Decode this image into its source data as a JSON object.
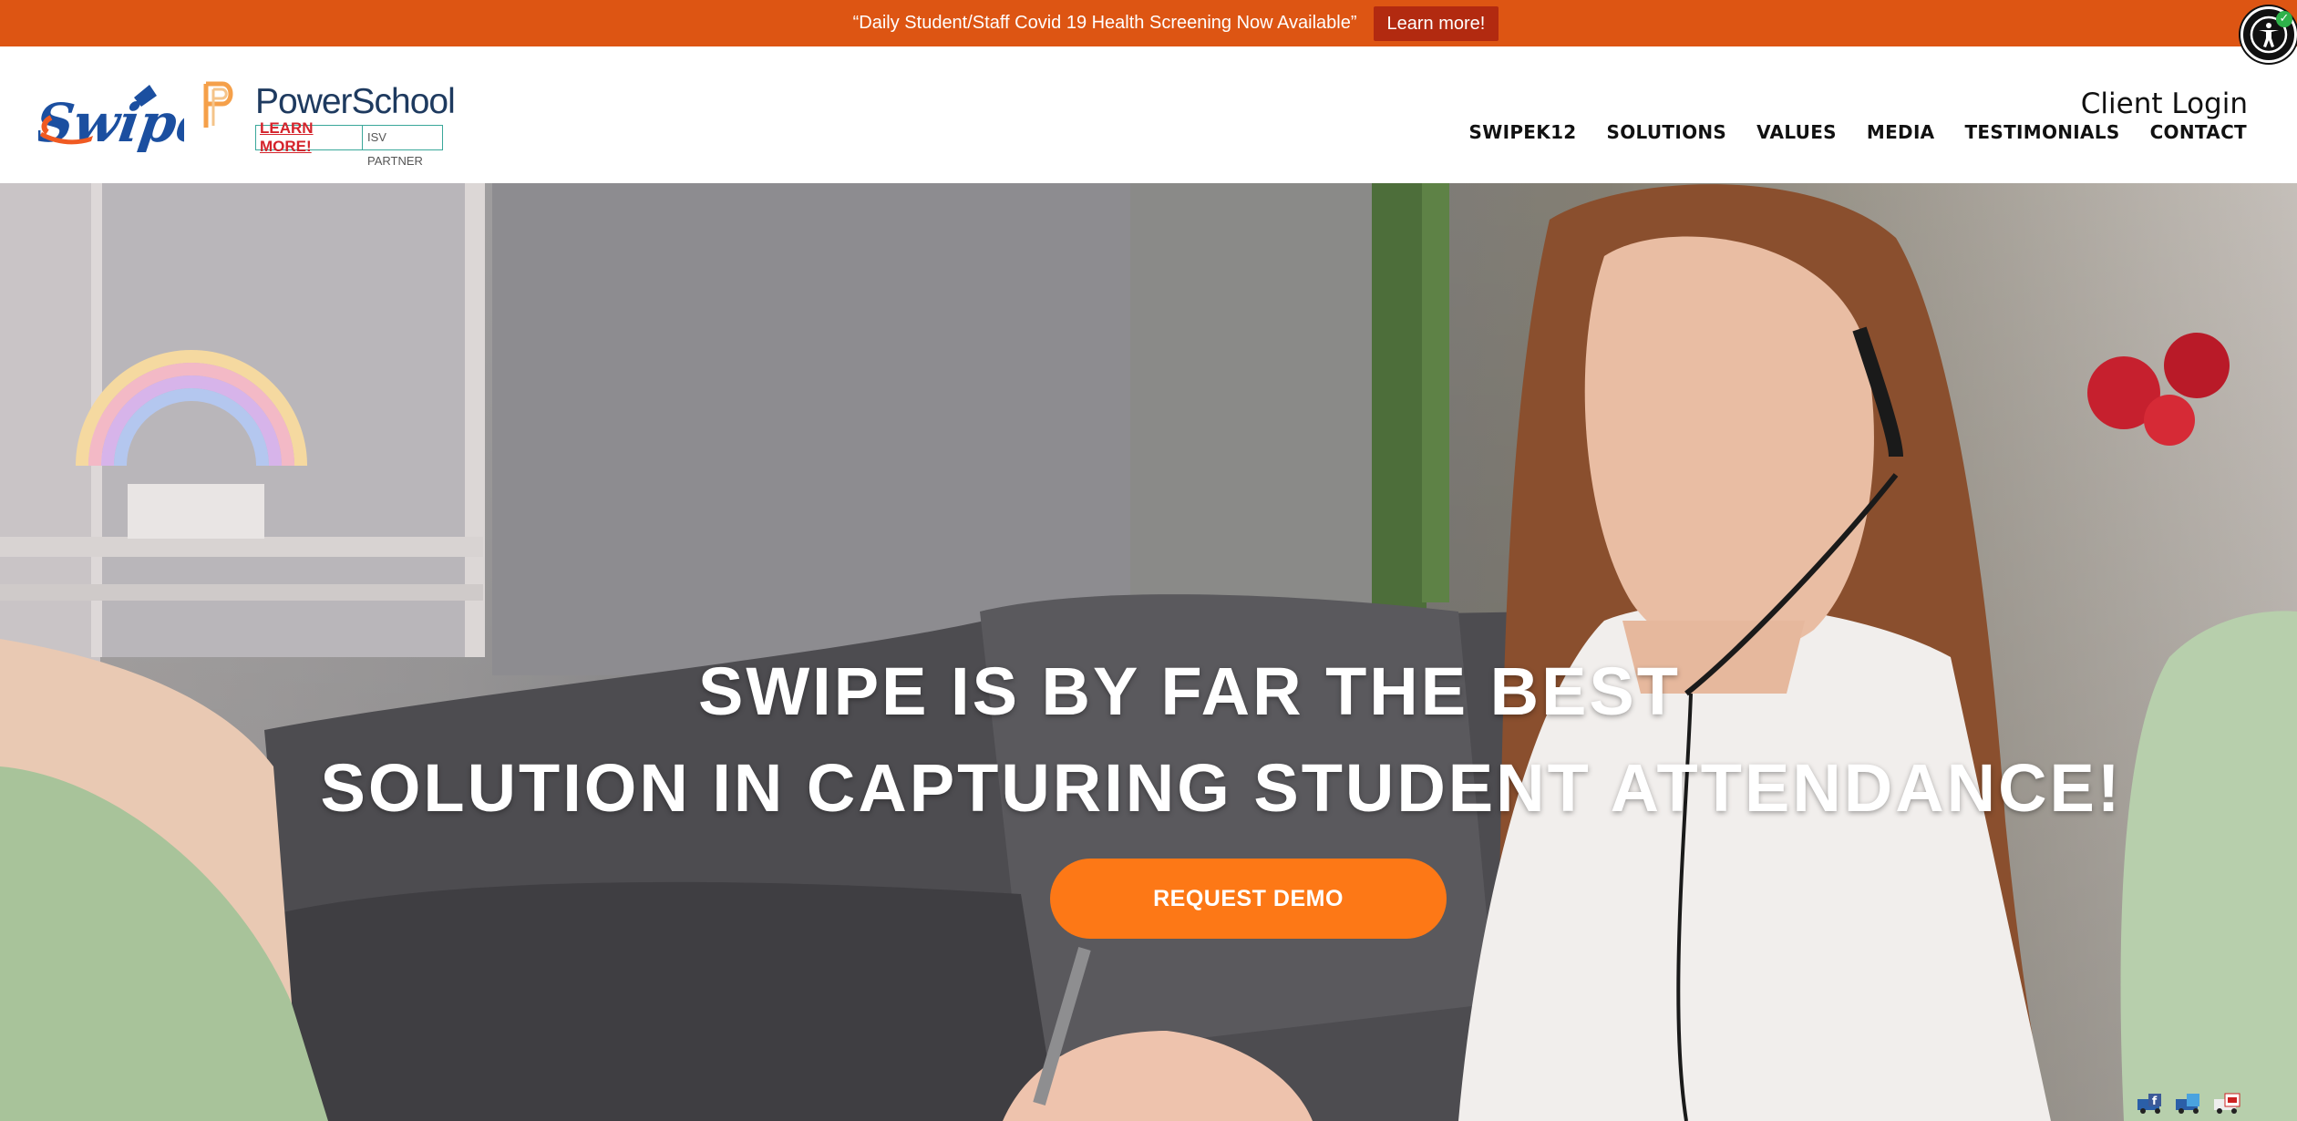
{
  "announcement": {
    "text": "“Daily Student/Staff Covid 19 Health Screening Now Available”",
    "button_label": "Learn more!"
  },
  "header": {
    "logo_swipe_text": "Swipe",
    "powerschool": {
      "name": "PowerSchool",
      "learn_more": "LEARN MORE!",
      "partner": "ISV PARTNER"
    },
    "client_login": "Client Login",
    "nav": [
      "SWIPEK12",
      "SOLUTIONS",
      "VALUES",
      "MEDIA",
      "TESTIMONIALS",
      "CONTACT"
    ]
  },
  "hero": {
    "headline_line1": "SWIPE IS BY FAR THE BEST",
    "headline_line2": "SOLUTION IN CAPTURING STUDENT ATTENDANCE!",
    "cta_label": "REQUEST DEMO"
  },
  "social": [
    "facebook-icon",
    "twitter-icon",
    "youtube-icon"
  ],
  "colors": {
    "announcement_bg": "#dd5513",
    "announcement_button": "#b22a10",
    "cta": "#fd7816",
    "nav_text": "#111111"
  }
}
